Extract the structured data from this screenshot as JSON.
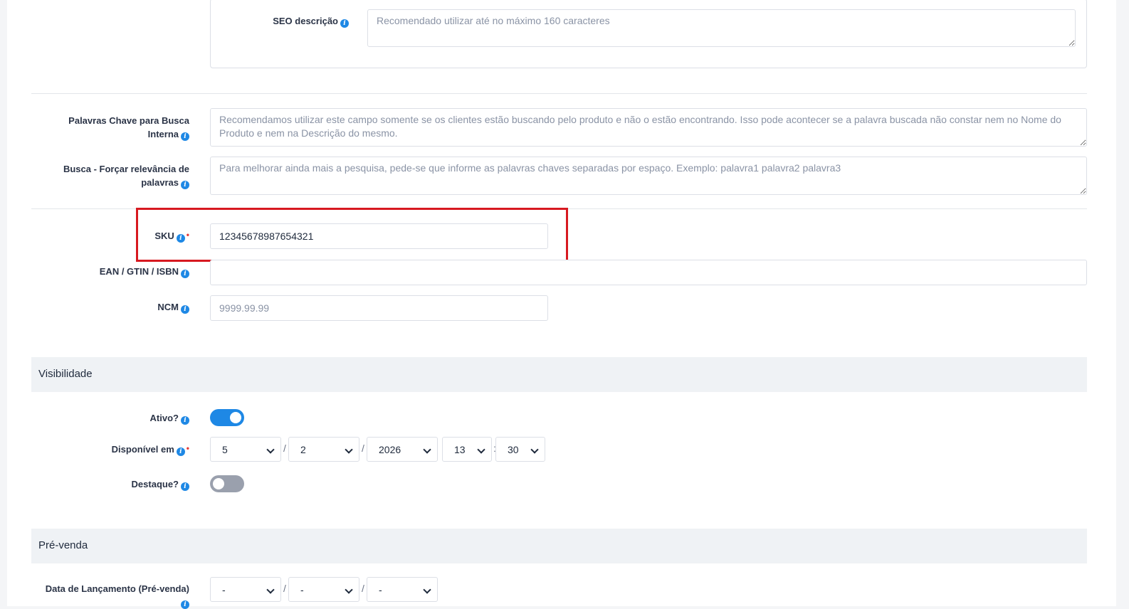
{
  "seo": {
    "label": "SEO descrição",
    "placeholder": "Recomendado utilizar até no máximo 160 caracteres"
  },
  "search": {
    "keywords_label": "Palavras Chave para Busca Interna",
    "keywords_placeholder": "Recomendamos utilizar este campo somente se os clientes estão buscando pelo produto e não o estão encontrando. Isso pode acontecer se a palavra buscada não constar nem no Nome do Produto e nem na Descrição do mesmo.",
    "relevance_label": "Busca - Forçar relevância de palavras",
    "relevance_placeholder": "Para melhorar ainda mais a pesquisa, pede-se que informe as palavras chaves separadas por espaço. Exemplo: palavra1 palavra2 palavra3"
  },
  "codes": {
    "sku_label": "SKU",
    "sku_value": "12345678987654321",
    "ean_label": "EAN / GTIN / ISBN",
    "ean_value": "",
    "ncm_label": "NCM",
    "ncm_placeholder": "9999.99.99"
  },
  "visibility": {
    "title": "Visibilidade",
    "active_label": "Ativo?",
    "active_on": true,
    "available_label": "Disponível em",
    "day": "5",
    "month": "2",
    "year": "2026",
    "hour": "13",
    "minute": "30",
    "date_sep": "/",
    "time_sep": ":",
    "featured_label": "Destaque?",
    "featured_on": false
  },
  "presale": {
    "title": "Pré-venda",
    "launch_label": "Data de Lançamento (Pré-venda)",
    "day": "-",
    "month": "-",
    "year": "-"
  },
  "colors": {
    "accent": "#1e88e5",
    "toggle_off": "#9aa0ad",
    "highlight": "#d71920",
    "required": "#e53935"
  },
  "icons": {
    "info": "i"
  }
}
